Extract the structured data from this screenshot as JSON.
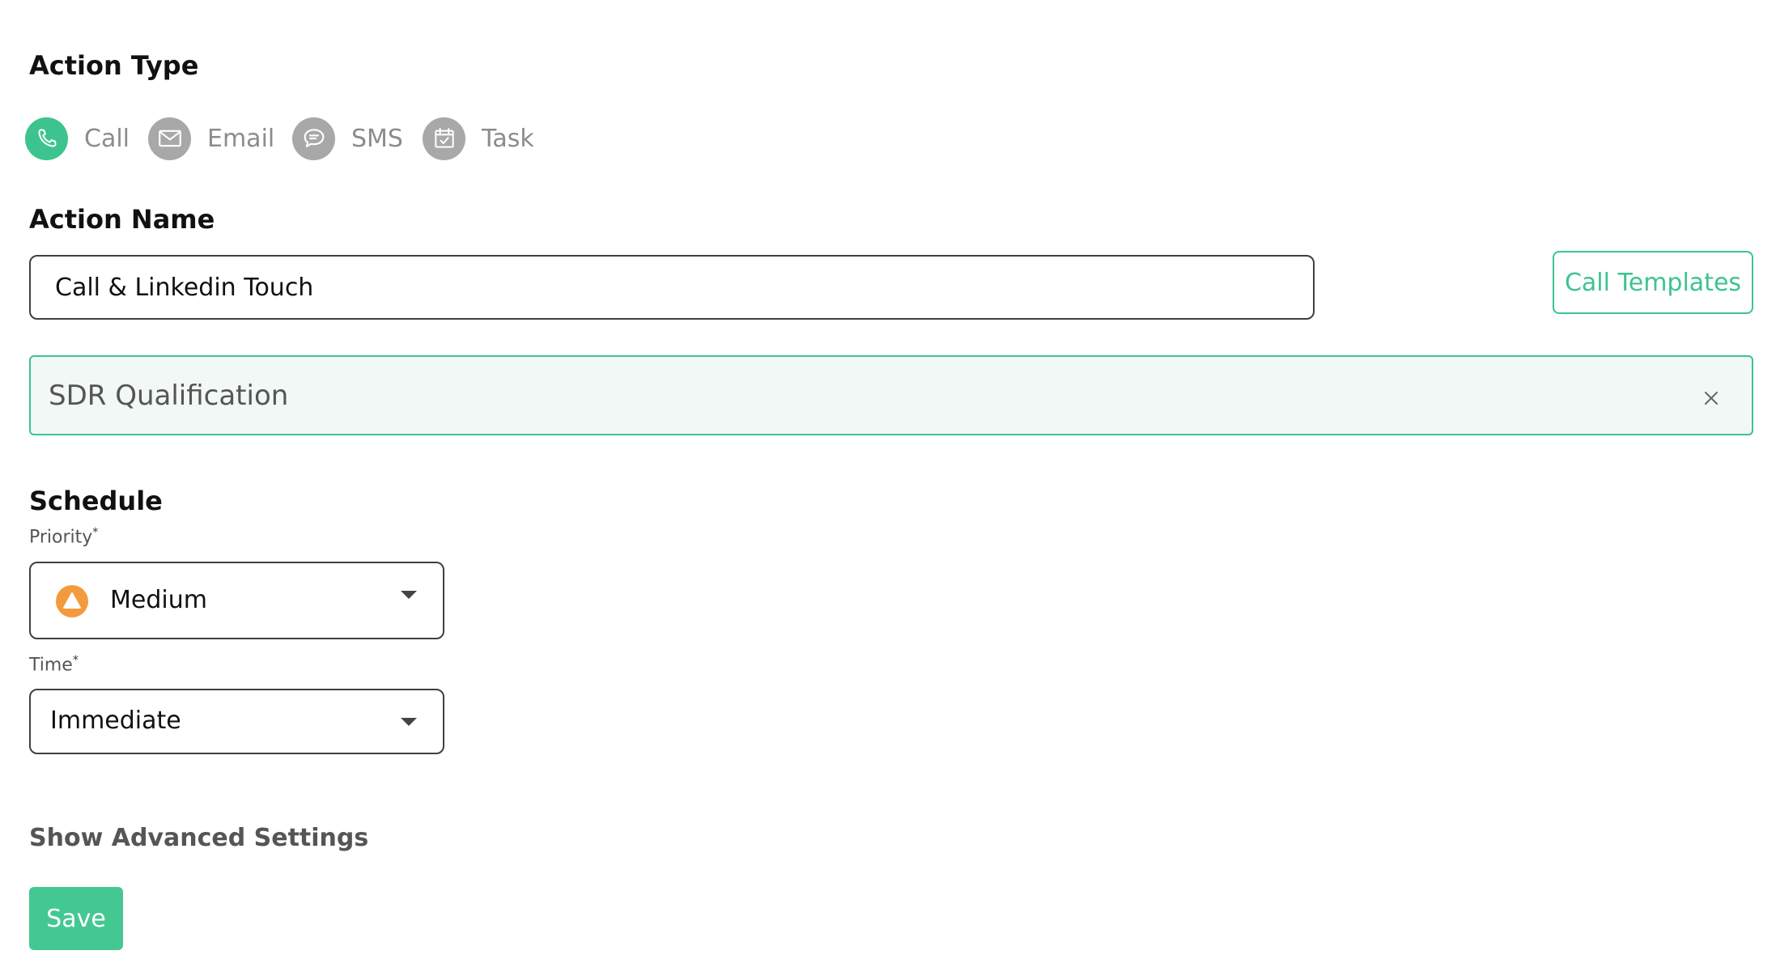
{
  "action_type": {
    "title": "Action Type",
    "options": [
      {
        "label": "Call",
        "icon": "phone-icon",
        "selected": true
      },
      {
        "label": "Email",
        "icon": "envelope-icon",
        "selected": false
      },
      {
        "label": "SMS",
        "icon": "chat-bubble-icon",
        "selected": false
      },
      {
        "label": "Task",
        "icon": "calendar-check-icon",
        "selected": false
      }
    ]
  },
  "action_name": {
    "title": "Action Name",
    "value": "Call & Linkedin Touch",
    "templates_button": "Call Templates"
  },
  "script_chip": {
    "label": "SDR Qualification",
    "close_icon": "close-icon"
  },
  "schedule": {
    "title": "Schedule",
    "priority": {
      "label": "Priority",
      "required_mark": "*",
      "value": "Medium",
      "icon": "warning-triangle-icon"
    },
    "time": {
      "label": "Time",
      "required_mark": "*",
      "value": "Immediate"
    }
  },
  "advanced": {
    "label": "Show Advanced Settings"
  },
  "save": {
    "label": "Save"
  },
  "colors": {
    "accent": "#3dc48e",
    "inactive_icon": "#a8a8a8",
    "priority_medium": "#f39a3d",
    "chip_background": "#f1f8f5"
  }
}
